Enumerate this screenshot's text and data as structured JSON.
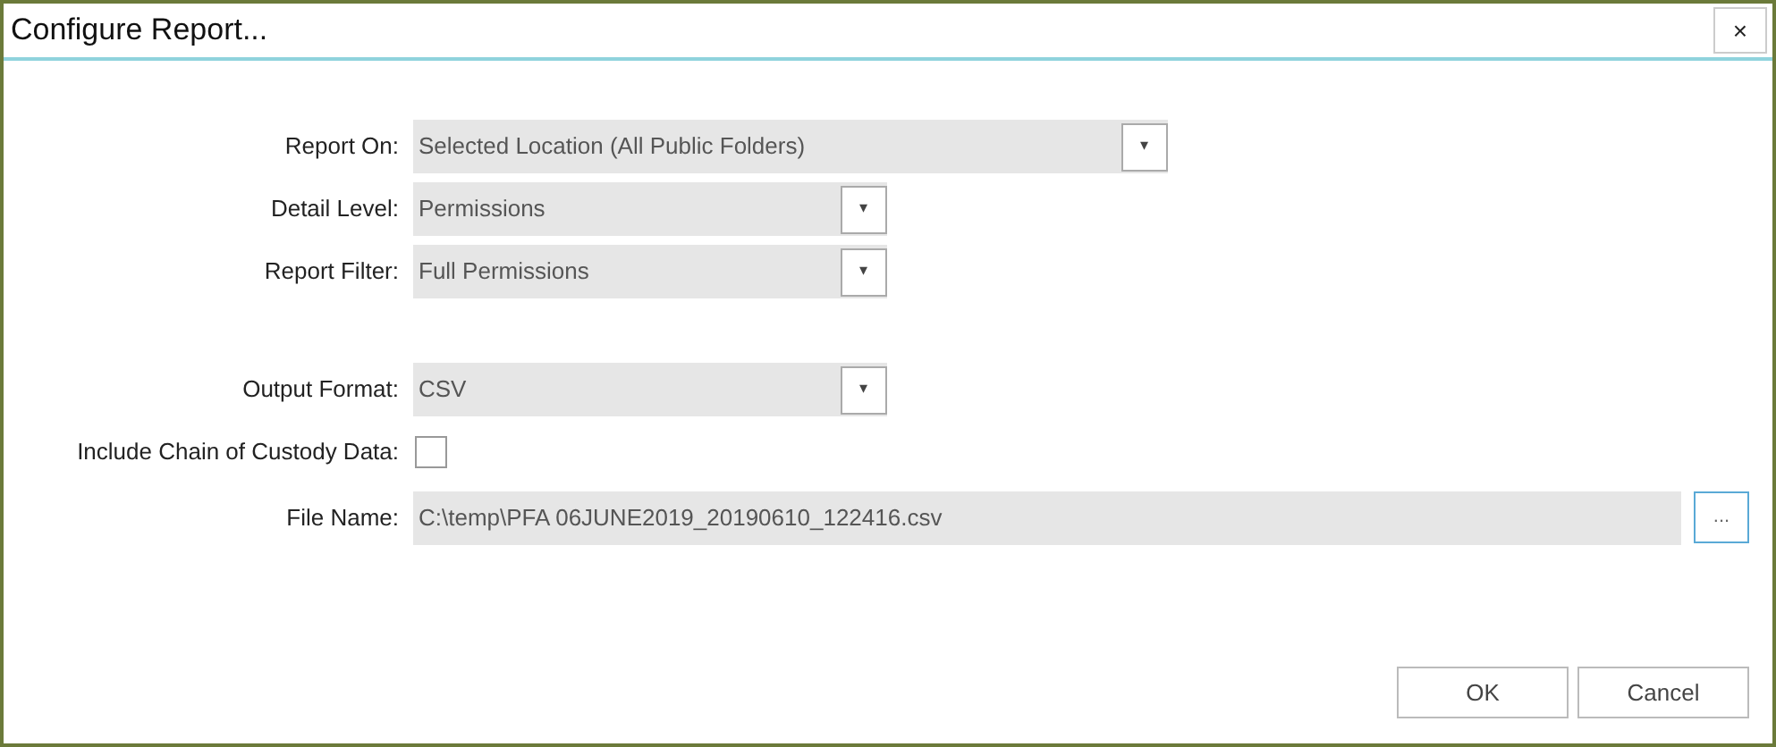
{
  "window": {
    "title": "Configure Report...",
    "close": "×"
  },
  "fields": [
    {
      "kind": "dropdown",
      "label": "Report On:",
      "value": "Selected Location (All Public Folders)",
      "caret": "▾"
    },
    {
      "kind": "dropdown",
      "label": "Detail Level:",
      "value": "Permissions",
      "caret": "▾"
    },
    {
      "kind": "dropdown",
      "label": "Report Filter:",
      "value": "Full Permissions",
      "caret": "▾"
    },
    {
      "kind": "dropdown",
      "label": "Output Format:",
      "value": "CSV",
      "caret": "▾"
    },
    {
      "kind": "checkbox",
      "label": "Include Chain of Custody Data:",
      "checked": false
    },
    {
      "kind": "file",
      "label": "File Name:",
      "value": "C:\\temp\\PFA 06JUNE2019_20190610_122416.csv",
      "browse": "..."
    }
  ],
  "buttons": [
    "OK",
    "Cancel"
  ]
}
